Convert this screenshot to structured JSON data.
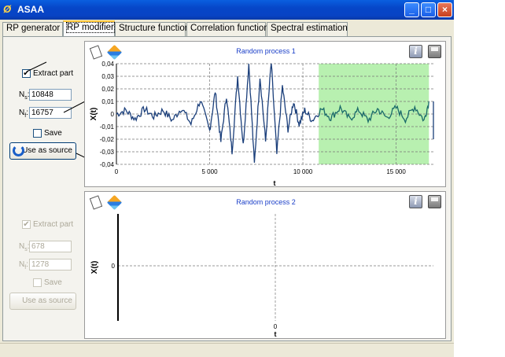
{
  "window": {
    "title": "ASAA",
    "app_icon": "asaa-logo-icon",
    "minimize_icon": "minimize-icon",
    "maximize_icon": "maximize-icon",
    "close_icon": "close-icon"
  },
  "tabs": [
    {
      "label": "RP generator",
      "active": false
    },
    {
      "label": "RP modifier",
      "active": true
    },
    {
      "label": "Structure function",
      "active": false
    },
    {
      "label": "Correlation function",
      "active": false
    },
    {
      "label": "Spectral estimation",
      "active": false
    }
  ],
  "section1": {
    "extract_label": "Extract part",
    "extract_checked": true,
    "ns_label": "N",
    "ns_sub": "s",
    "ns_value": "10848",
    "nf_label": "N",
    "nf_sub": "f",
    "nf_value": "16757",
    "save_label": "Save",
    "save_checked": false,
    "use_source_label": "Use as source"
  },
  "section2": {
    "extract_label": "Extract part",
    "extract_checked": true,
    "ns_label": "N",
    "ns_sub": "s",
    "ns_value": "678",
    "nf_label": "N",
    "nf_sub": "f",
    "nf_value": "1278",
    "save_label": "Save",
    "save_checked": false,
    "use_source_label": "Use as source",
    "disabled": true
  },
  "chart_data": [
    {
      "type": "line",
      "title": "Random process 1",
      "xlabel": "t",
      "ylabel": "X(t)",
      "xlim": [
        0,
        17000
      ],
      "ylim": [
        -0.04,
        0.04
      ],
      "x_ticks": [
        "0",
        "5 000",
        "10 000",
        "15 000"
      ],
      "y_ticks": [
        "0,04",
        "0,03",
        "0,02",
        "0,01",
        "0",
        "-0,01",
        "-0,02",
        "-0,03",
        "-0,04"
      ],
      "highlight_range": [
        10848,
        16757
      ],
      "highlight_color": "#b8f0b0",
      "line_color": "#1a3e7a",
      "highlight_line_color": "#1a6a6a",
      "grid": true,
      "series": [
        {
          "x": [
            0,
            500,
            1000,
            1500,
            2000,
            2500,
            3000,
            3500,
            4000,
            4500,
            5000,
            5300,
            5600,
            5900,
            6200,
            6500,
            6800,
            7100,
            7400,
            7700,
            8000,
            8300,
            8600,
            8900,
            9200,
            9500,
            9800,
            10100,
            10500,
            11000,
            11500,
            12000,
            12500,
            13000,
            13500,
            14000,
            14500,
            15000,
            15500,
            16000,
            16500,
            16757
          ],
          "values": [
            0.0,
            0.003,
            -0.004,
            0.004,
            -0.002,
            0.003,
            -0.005,
            0.005,
            -0.008,
            0.011,
            -0.013,
            0.018,
            -0.022,
            0.015,
            -0.03,
            0.03,
            -0.025,
            0.04,
            -0.04,
            0.03,
            -0.022,
            0.042,
            -0.032,
            0.022,
            -0.012,
            0.01,
            -0.008,
            0.003,
            -0.005,
            0.004,
            -0.003,
            0.005,
            -0.004,
            0.003,
            -0.005,
            0.004,
            -0.003,
            0.005,
            -0.004,
            0.006,
            -0.005,
            0.01
          ]
        }
      ]
    },
    {
      "type": "line",
      "title": "Random process 2",
      "xlabel": "t",
      "ylabel": "X(t)",
      "x_ticks": [
        "0"
      ],
      "y_ticks": [
        "0"
      ],
      "grid": true,
      "series": []
    }
  ],
  "plot_icons": {
    "left1": "page-icon",
    "left2": "cube-icon",
    "right1": "info-icon",
    "right2": "save-disk-icon"
  },
  "status_text": ""
}
